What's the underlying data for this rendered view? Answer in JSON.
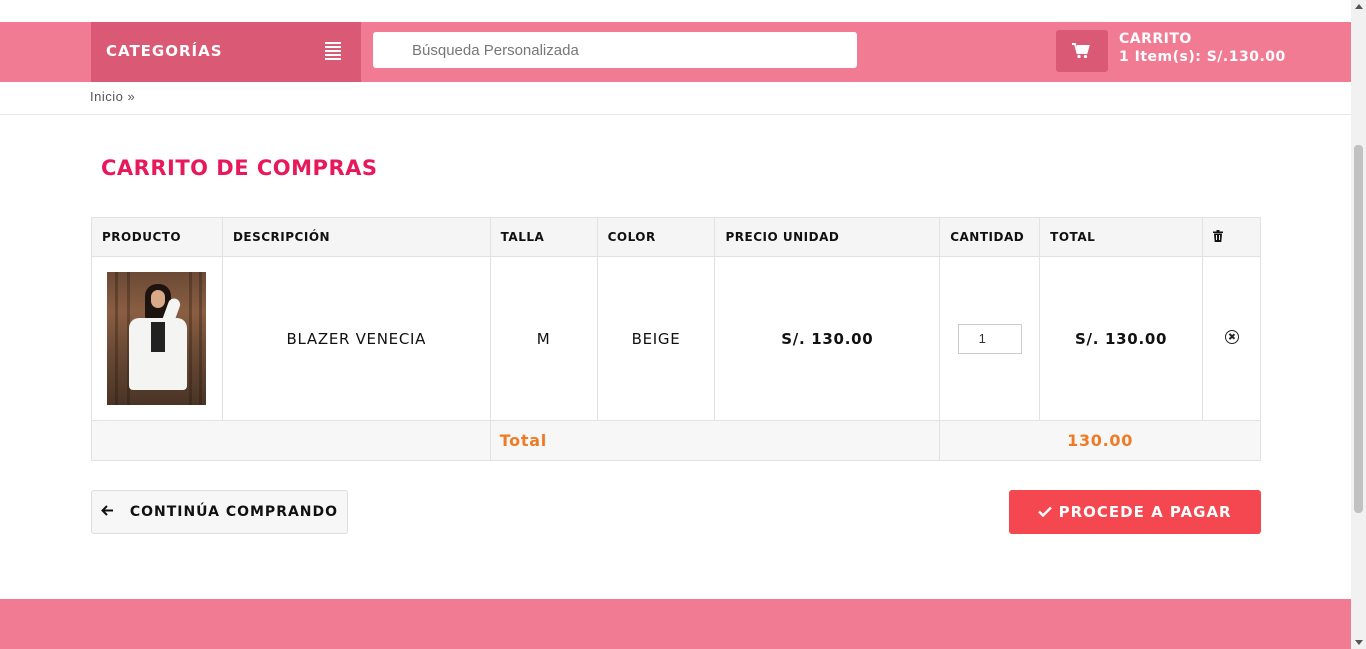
{
  "header": {
    "categories_label": "CATEGORÍAS",
    "search_placeholder": "Búsqueda Personalizada",
    "cart_title": "CARRITO",
    "cart_summary": "1 Item(s): S/.130.00"
  },
  "breadcrumb": "Inicio »",
  "page_title": "CARRITO DE COMPRAS",
  "table": {
    "headers": [
      "PRODUCTO",
      "DESCRIPCIÓN",
      "TALLA",
      "COLOR",
      "PRECIO UNIDAD",
      "CANTIDAD",
      "TOTAL"
    ],
    "rows": [
      {
        "description": "BLAZER VENECIA",
        "size": "M",
        "color": "BEIGE",
        "unit_price": "S/. 130.00",
        "quantity": "1",
        "total": "S/. 130.00"
      }
    ],
    "total_label": "Total",
    "total_value": "130.00"
  },
  "buttons": {
    "continue": "CONTINÚA COMPRANDO",
    "pay": "PROCEDE A PAGAR"
  },
  "icons": {
    "menu": "menu-icon",
    "cart": "cart-icon",
    "trash": "trash-icon",
    "remove": "remove-circle-icon",
    "arrow_left": "arrow-left-icon",
    "check": "check-icon"
  },
  "colors": {
    "header_bg": "#f07b93",
    "categories_bg": "#da5a75",
    "title": "#e8185c",
    "price": "#e63946",
    "total": "#f07b27",
    "pay_button": "#f4474f"
  }
}
